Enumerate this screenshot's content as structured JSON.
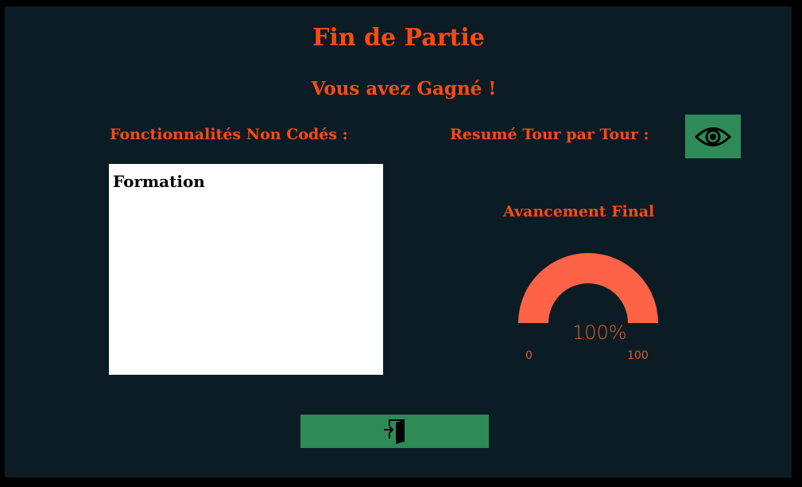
{
  "title": "Fin de Partie",
  "subtitle": "Vous avez Gagné !",
  "missing_features": {
    "label": "Fonctionnalités Non Codés :",
    "items": [
      "Formation"
    ]
  },
  "summary": {
    "label": "Resumé Tour par Tour :",
    "button_icon": "eye-icon"
  },
  "progress": {
    "label": "Avancement Final",
    "value": 100,
    "display": "100%",
    "min": "0",
    "max": "100"
  },
  "exit_button": {
    "icon": "exit-door-icon"
  },
  "colors": {
    "accent": "#ff4a12",
    "gauge": "#ff6347",
    "button": "#2e8b57",
    "background": "#0b1c24"
  }
}
